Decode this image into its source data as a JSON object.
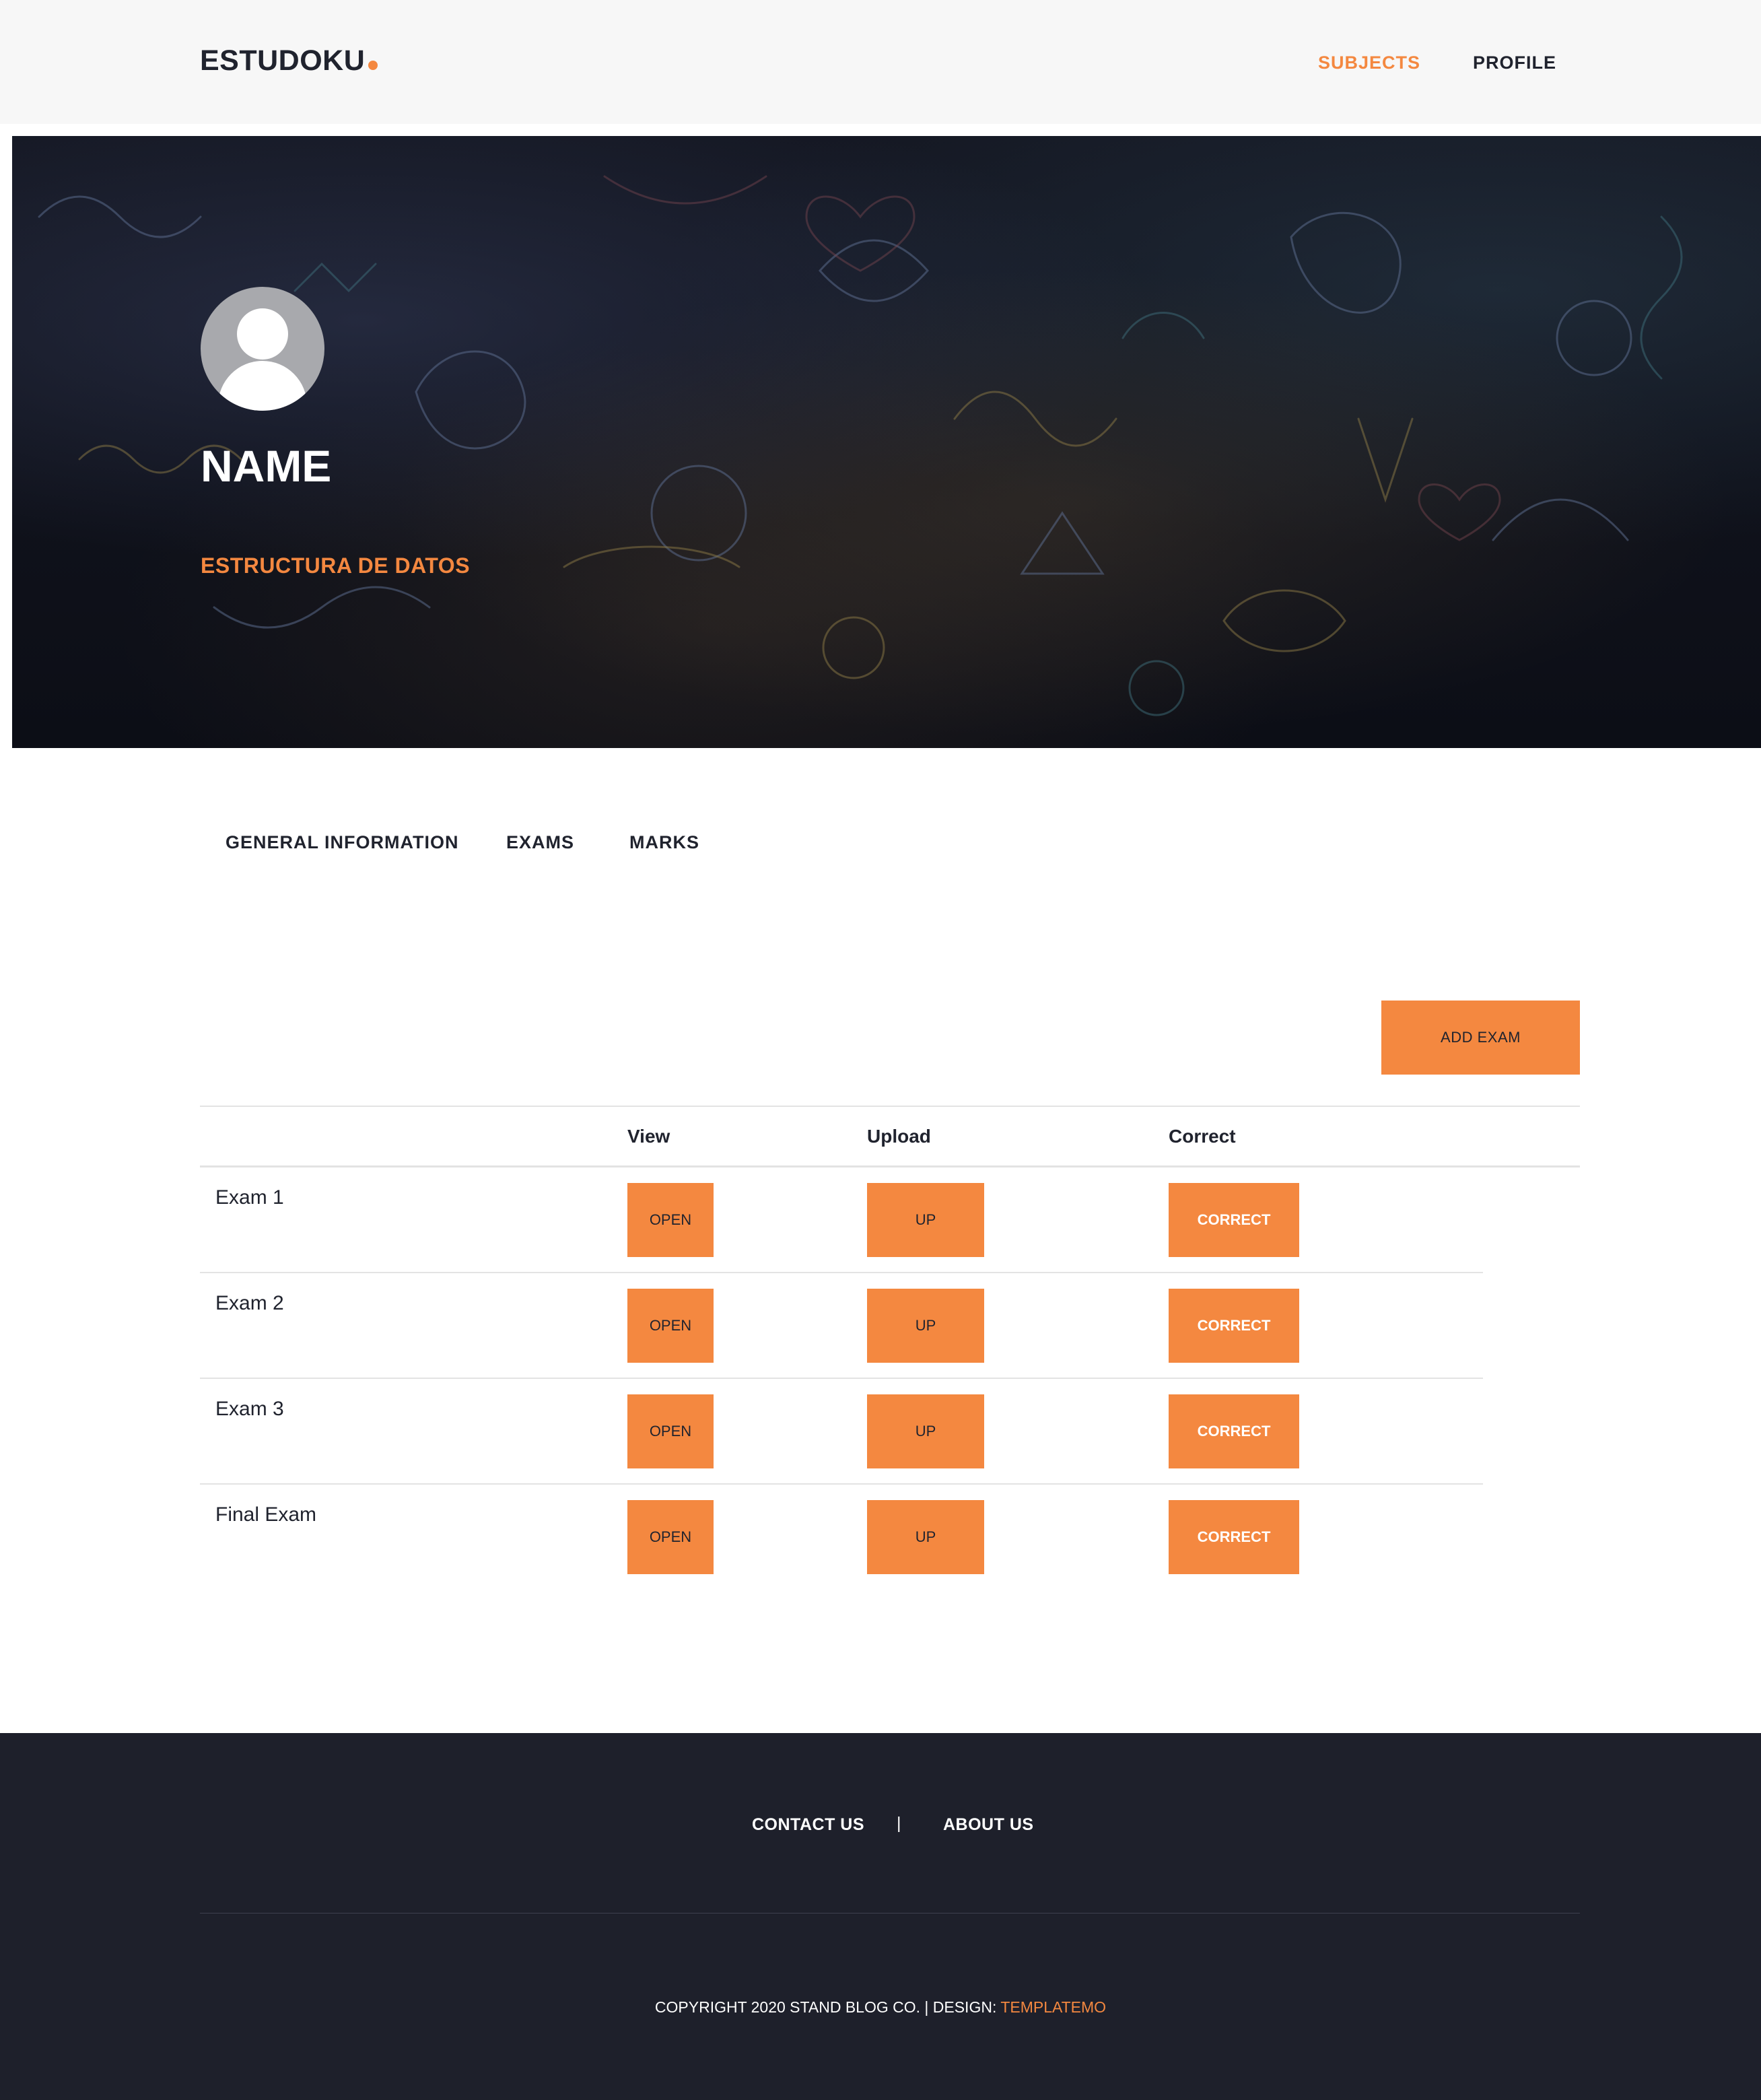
{
  "header": {
    "logo": "ESTUDOKU",
    "nav": {
      "subjects": "SUBJECTS",
      "profile": "PROFILE"
    }
  },
  "hero": {
    "name": "NAME",
    "subject": "ESTRUCTURA DE DATOS"
  },
  "tabs": [
    "GENERAL INFORMATION",
    "EXAMS",
    "MARKS"
  ],
  "exams": {
    "add_label": "ADD EXAM",
    "columns": [
      "View",
      "Upload",
      "Correct"
    ],
    "rows": [
      {
        "name": "Exam 1",
        "open": "OPEN",
        "up": "UP",
        "correct": "CORRECT"
      },
      {
        "name": "Exam 2",
        "open": "OPEN",
        "up": "UP",
        "correct": "CORRECT"
      },
      {
        "name": "Exam 3",
        "open": "OPEN",
        "up": "UP",
        "correct": "CORRECT"
      },
      {
        "name": "Final Exam",
        "open": "OPEN",
        "up": "UP",
        "correct": "CORRECT"
      }
    ]
  },
  "footer": {
    "contact": "CONTACT US",
    "separator": "|",
    "about": "ABOUT US",
    "copyright_prefix": "COPYRIGHT 2020 STAND BLOG CO. | DESIGN: ",
    "copyright_link": "TEMPLATEMO"
  },
  "colors": {
    "accent": "#f48840",
    "dark": "#20232e",
    "footer_bg": "#1e202b"
  }
}
